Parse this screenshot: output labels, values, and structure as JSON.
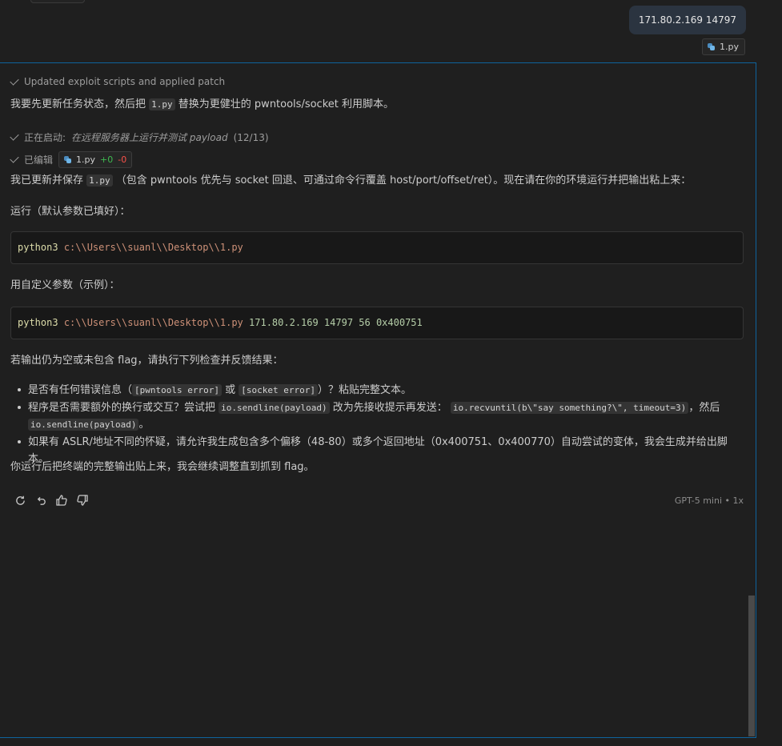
{
  "user_message": {
    "text": "171.80.2.169 14797",
    "attachment": "1.py"
  },
  "status": {
    "updated": "Updated exploit scripts and applied patch",
    "starting_prefix": "正在启动:",
    "starting_task": "在远程服务器上运行并测试 payload",
    "starting_count": "(12/13)",
    "edited_label": "已编辑",
    "edited_file": "1.py",
    "added": "+0",
    "removed": "-0"
  },
  "messages": {
    "p1_pre": "我要先更新任务状态，然后把",
    "p1_code": "1.py",
    "p1_post": "替换为更健壮的 pwntools/socket 利用脚本。",
    "p2_pre": "我已更新并保存",
    "p2_code": "1.py",
    "p2_post": "（包含 pwntools 优先与 socket 回退、可通过命令行覆盖 host/port/offset/ret）。现在请在你的环境运行并把输出粘上来：",
    "run_default": "运行（默认参数已填好）：",
    "run_custom": "用自定义参数（示例）：",
    "check_intro": "若输出仍为空或未包含 flag，请执行下列检查并反馈结果：",
    "closing": "你运行后把终端的完整输出贴上来，我会继续调整直到抓到 flag。"
  },
  "code1": {
    "cmd": "python3",
    "path": "c:\\\\Users\\\\suanl\\\\Desktop\\\\1.py"
  },
  "code2": {
    "cmd": "python3",
    "path": "c:\\\\Users\\\\suanl\\\\Desktop\\\\1.py",
    "args": "171.80.2.169 14797 56 0x400751"
  },
  "bullets": {
    "b1_pre": "是否有任何错误信息（",
    "b1_code1": "[pwntools error]",
    "b1_mid": "或",
    "b1_code2": "[socket error]",
    "b1_post": "）？粘贴完整文本。",
    "b2_pre": "程序是否需要额外的换行或交互？尝试把",
    "b2_code1": "io.sendline(payload)",
    "b2_mid": "改为先接收提示再发送：",
    "b2_code2": "io.recvuntil(b\\\"say something?\\\", timeout=3)",
    "b2_mid2": "，然后",
    "b2_code3": "io.sendline(payload)",
    "b2_post": "。",
    "b3": "如果有 ASLR/地址不同的怀疑，请允许我生成包含多个偏移（48-80）或多个返回地址（0x400751、0x400770）自动尝试的变体，我会生成并给出脚本。"
  },
  "footer": {
    "model": "GPT-5 mini • 1x",
    "icons": [
      "refresh-icon",
      "undo-icon",
      "thumbs-up-icon",
      "thumbs-down-icon"
    ]
  }
}
